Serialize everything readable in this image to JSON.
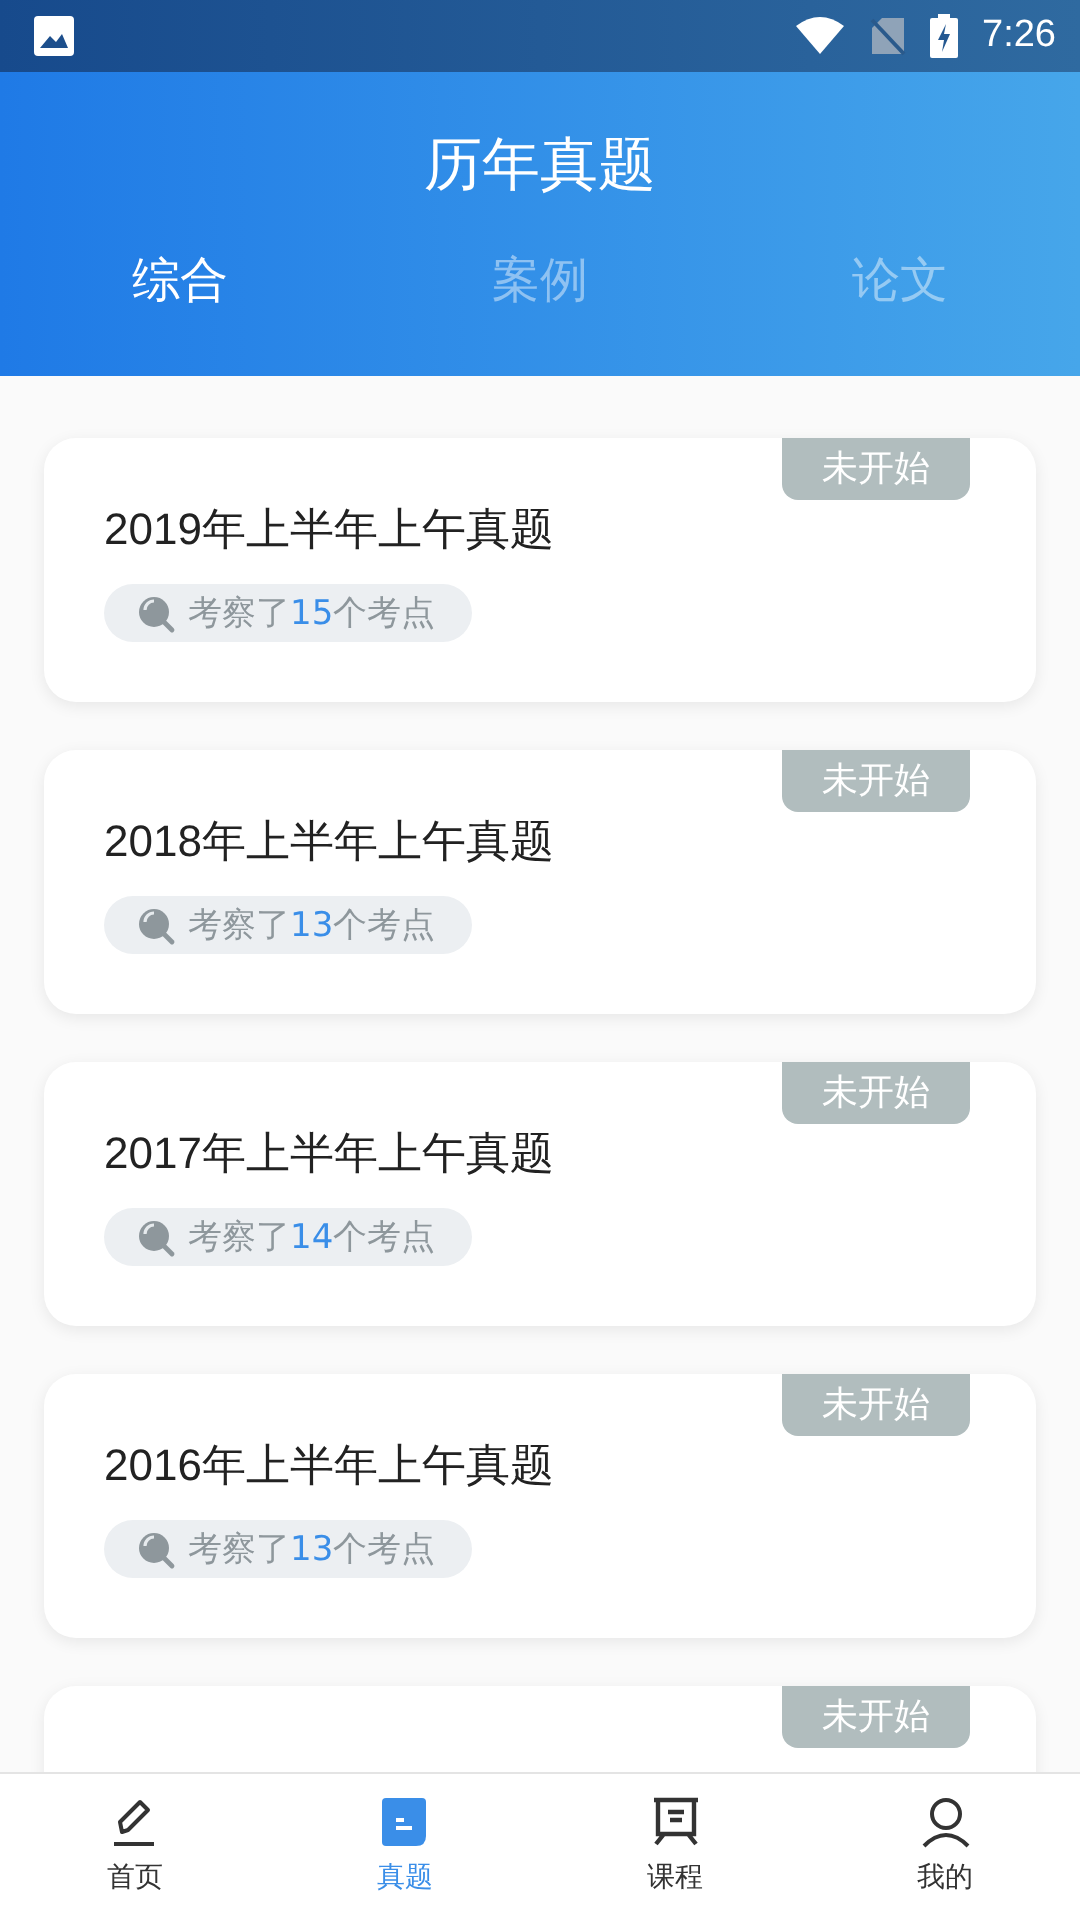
{
  "status_bar": {
    "time": "7:26"
  },
  "header": {
    "title": "历年真题"
  },
  "tabs": [
    {
      "label": "综合",
      "selected": true
    },
    {
      "label": "案例",
      "selected": false
    },
    {
      "label": "论文",
      "selected": false
    }
  ],
  "papers": [
    {
      "title": "2019年上半年上午真题",
      "status": "未开始",
      "points_before": "考察了",
      "points_count": "15",
      "points_after": "个考点"
    },
    {
      "title": "2018年上半年上午真题",
      "status": "未开始",
      "points_before": "考察了",
      "points_count": "13",
      "points_after": "个考点"
    },
    {
      "title": "2017年上半年上午真题",
      "status": "未开始",
      "points_before": "考察了",
      "points_count": "14",
      "points_after": "个考点"
    },
    {
      "title": "2016年上半年上午真题",
      "status": "未开始",
      "points_before": "考察了",
      "points_count": "13",
      "points_after": "个考点"
    },
    {
      "status": "未开始"
    }
  ],
  "bottom_nav": [
    {
      "label": "首页",
      "kind": "pencil",
      "selected": false
    },
    {
      "label": "真题",
      "kind": "paper",
      "selected": true
    },
    {
      "label": "课程",
      "kind": "board",
      "selected": false
    },
    {
      "label": "我的",
      "kind": "person",
      "selected": false
    }
  ]
}
